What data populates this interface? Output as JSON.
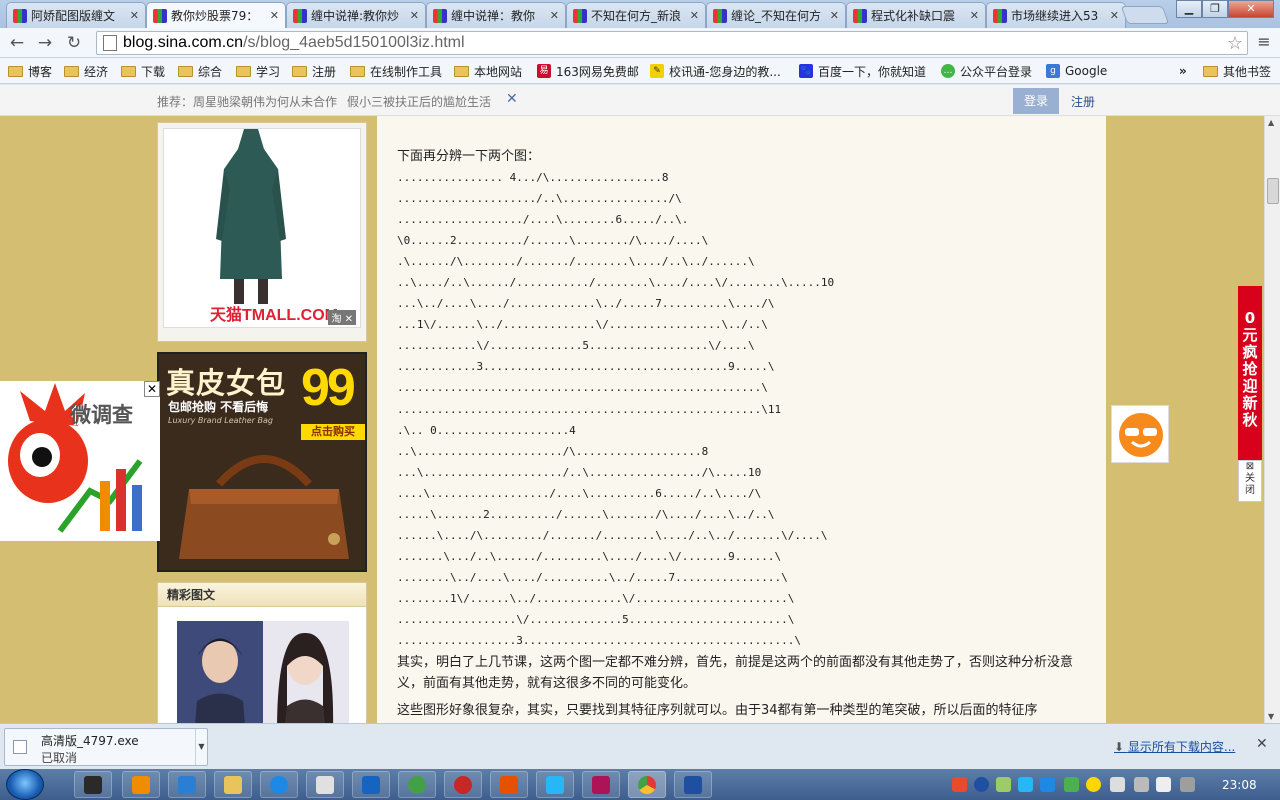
{
  "browser": {
    "tabs": [
      {
        "title": "阿娇配图版缠文"
      },
      {
        "title": "教你炒股票79："
      },
      {
        "title": "缠中说禅:教你炒"
      },
      {
        "title": "缠中说禅：教你"
      },
      {
        "title": "不知在何方_新浪"
      },
      {
        "title": "缠论_不知在何方"
      },
      {
        "title": "程式化补缺口震"
      },
      {
        "title": "市场继续进入53"
      }
    ],
    "active_tab": 1,
    "url_domain": "blog.sina.com.cn",
    "url_path": "/s/blog_4aeb5d150100l3iz.html",
    "bookmarks": [
      {
        "label": "博客",
        "icon": "folder-icon"
      },
      {
        "label": "经济",
        "icon": "folder-icon"
      },
      {
        "label": "下载",
        "icon": "folder-icon"
      },
      {
        "label": "综合",
        "icon": "folder-icon"
      },
      {
        "label": "学习",
        "icon": "folder-icon"
      },
      {
        "label": "注册",
        "icon": "folder-icon"
      },
      {
        "label": "在线制作工具",
        "icon": "folder-icon"
      },
      {
        "label": "本地网站",
        "icon": "folder-icon"
      },
      {
        "label": "163网易免费邮",
        "icon": "netease-icon"
      },
      {
        "label": "校讯通-您身边的教...",
        "icon": "xiaoxuntong-icon"
      },
      {
        "label": "百度一下，你就知道",
        "icon": "baidu-icon"
      },
      {
        "label": "公众平台登录",
        "icon": "wechat-icon"
      },
      {
        "label": "Google",
        "icon": "google-icon"
      }
    ],
    "bookmarks_more": "»",
    "other_bookmarks": "其他书签"
  },
  "sinabar": {
    "recommend_prefix": "推荐：",
    "rec1": "周星驰梁朝伟为何从未合作",
    "rec2": "假小三被扶正后的尴尬生活",
    "login": "登录",
    "register": "注册"
  },
  "ads": {
    "tmall_text": "天猫TMALL.COM",
    "tao_tag": "淘",
    "bag_title": "真皮女包",
    "bag_sub": "包邮抢购 不看后悔",
    "bag_sub_en": "Luxury Brand Leather Bag",
    "bag_price": "99",
    "bag_buy": "点击购买",
    "survey_text": "微调查",
    "red_vertical": "0元疯抢迎新秋",
    "red_close": "关闭"
  },
  "sidebar": {
    "jingcai_title": "精彩图文"
  },
  "article": {
    "intro": "下面再分辨一下两个图：",
    "diagram1": [
      "................ 4.../\\.................8",
      "...................../..\\................/\\",
      ".................../....\\........6...../..\\.",
      "\\0......2........../......\\......../\\..../....\\",
      ".\\....../\\......../......./........\\..../..\\../......\\",
      "..\\..../..\\....../.........../........\\..../....\\/........\\.....10",
      "...\\../....\\..../.............\\../.....7..........\\..../\\",
      "...1\\/......\\../..............\\/.................\\../..\\",
      "............\\/..............5..................\\/....\\",
      "............3.....................................9.....\\",
      ".......................................................\\",
      ".......................................................\\11"
    ],
    "diagram2": [
      ".\\.. 0....................4",
      "..\\....................../\\...................8",
      "...\\...................../..\\................./\\.....10",
      "....\\................../....\\..........6...../..\\..../\\",
      ".....\\.......2........../......\\......./\\..../....\\../..\\",
      "......\\..../\\........./......./........\\..../..\\../.......\\/....\\",
      ".......\\.../..\\....../.........\\..../....\\/.......9......\\",
      "........\\../....\\..../..........\\../.....7................\\",
      "........1\\/......\\../.............\\/.......................\\",
      "..................\\/..............5........................\\",
      "..................3.........................................\\"
    ],
    "para1": "其实，明白了上几节课，这两个图一定都不难分辨，首先，前提是这两个的前面都没有其他走势了，否则这种分析没意义，前面有其他走势，就有这很多不同的可能变化。",
    "para2": "这些图形好象很复杂，其实，只要找到其特征序列就可以。由于34都有第一种类型的笔突破，所以后面的特征序"
  },
  "download": {
    "file": "高清版_4797.exe",
    "status": "已取消",
    "show_all": "显示所有下载内容..."
  },
  "taskbar": {
    "time": "23:08"
  },
  "colors": {
    "page_bg": "#d4be72",
    "article_bg": "#f9f7ee",
    "accent_red": "#d8001a"
  }
}
